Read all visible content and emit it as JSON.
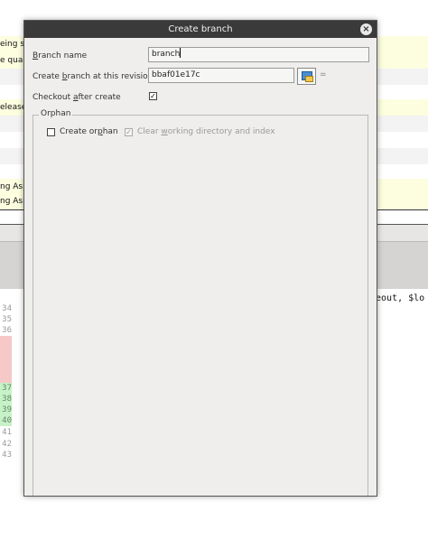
{
  "background": {
    "snippets": [
      {
        "text": "eing sh"
      },
      {
        "text": "e quali"
      },
      {
        "text": "elease"
      },
      {
        "text": "ng Asp"
      },
      {
        "text": "ng Asp"
      }
    ],
    "code_fragment": "neout, $lo",
    "line_numbers": [
      "34",
      "35",
      "36",
      "37",
      "38",
      "39",
      "40",
      "41",
      "42",
      "43"
    ]
  },
  "dialog": {
    "title": "Create branch",
    "close_icon": "close-icon",
    "branch_name": {
      "label_pre": "",
      "label_u": "B",
      "label_post": "ranch name",
      "value": "branch"
    },
    "revision": {
      "label_pre": "Create ",
      "label_u": "b",
      "label_post": "ranch at this revision",
      "value": "bbaf01e17c",
      "button_icon": "commit-picker-icon",
      "eq": "="
    },
    "checkout": {
      "label_pre": "Checkout ",
      "label_u": "a",
      "label_post": "fter create",
      "checked": true
    },
    "orphan": {
      "group_title": "Orphan",
      "create_orphan": {
        "label_pre": "Create or",
        "label_u": "p",
        "label_post": "han",
        "checked": false
      },
      "clear_dir": {
        "label_pre": "Clear ",
        "label_u": "w",
        "label_post": "orking directory and index",
        "checked": true,
        "disabled": true
      }
    }
  },
  "colors": {
    "titlebar": "#3a3a3a",
    "dialog_bg": "#efeeed",
    "highlight_row": "#fdfde0",
    "diff_add": "#c7f2c7",
    "diff_del": "#f6c8c8"
  }
}
